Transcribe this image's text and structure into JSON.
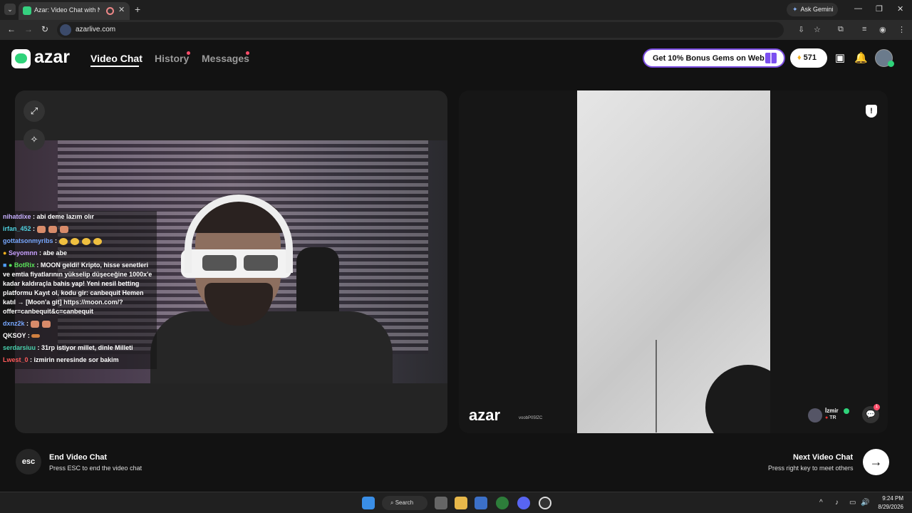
{
  "browser": {
    "tab_title": "Azar: Video Chat with New",
    "ask_gemini": "Ask Gemini",
    "url": "azarlive.com"
  },
  "header": {
    "logo": "azar",
    "nav": [
      {
        "label": "Video Chat",
        "active": true
      },
      {
        "label": "History",
        "active": false
      },
      {
        "label": "Messages",
        "active": false
      }
    ],
    "bonus_label": "Get 10% Bonus Gems on Web!",
    "gem_count": "571"
  },
  "chat_overlay": [
    {
      "user": "nihatdixe",
      "message": ": abi deme lazım olır"
    },
    {
      "user": "irfan_452",
      "message": ":"
    },
    {
      "user": "gottatsonmyribs",
      "message": ":"
    },
    {
      "user": "Seyomnn",
      "message": ": abe abe"
    },
    {
      "user": "BotRix",
      "message": ": MOON geldi! Kripto, hisse senetleri ve emtia fiyatlarının yükselip düşeceğine 1000x'e kadar kaldıraçla bahis yap! Yeni nesil betting platformu Kayıt ol, kodu gir: canbequit Hemen katıl → [Moon'a git] https://moon.com/?offer=canbequit&c=canbequit"
    },
    {
      "user": "dxnz2k",
      "message": ":"
    },
    {
      "user": "QKSOY",
      "message": ":"
    },
    {
      "user": "serdarsiuu",
      "message": ": 31rp istiyor millet, dinle Milleti"
    },
    {
      "user": "Lwest_0",
      "message": ": izmirin neresinde sor bakim"
    }
  ],
  "remote": {
    "watermark": "azar",
    "watermark_id": "voobP05fZC",
    "city": "İzmir",
    "country": "TR",
    "chat_badge": "1"
  },
  "controls": {
    "esc_key": "esc",
    "end_title": "End Video Chat",
    "end_sub": "Press ESC to end the video chat",
    "next_title": "Next Video Chat",
    "next_sub": "Press right key to meet others",
    "next_icon": "→"
  },
  "taskbar": {
    "search": "Search",
    "time": "9:24 PM",
    "date": "8/29/2026"
  },
  "colors": {
    "brand_green": "#2fd37a",
    "bonus_border": "#7a4ce0",
    "notification_dot": "#ff4d6a"
  }
}
